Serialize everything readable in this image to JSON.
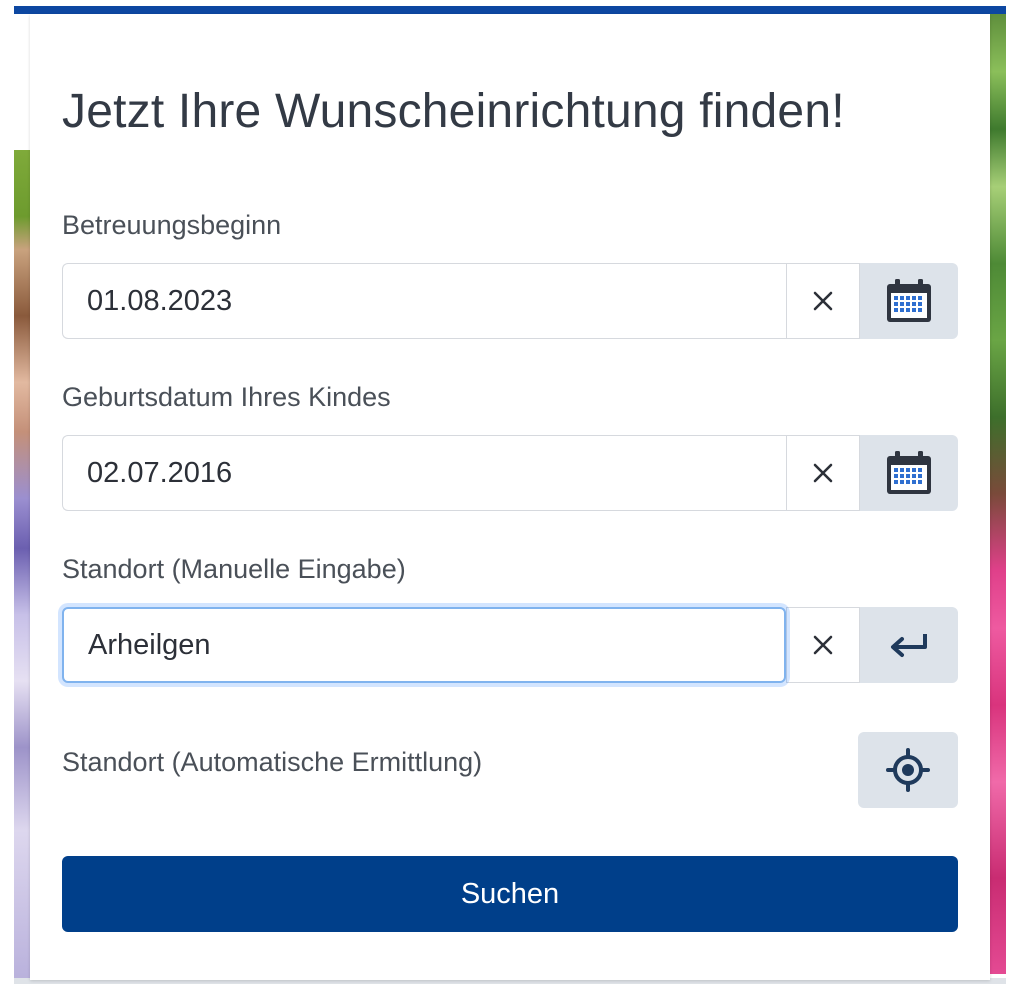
{
  "form": {
    "title": "Jetzt Ihre Wunscheinrichtung finden!",
    "care_start": {
      "label": "Betreuungsbeginn",
      "value": "01.08.2023",
      "clear_icon": "close-icon",
      "action_icon": "calendar-icon"
    },
    "birth_date": {
      "label": "Geburtsdatum Ihres Kindes",
      "value": "02.07.2016",
      "clear_icon": "close-icon",
      "action_icon": "calendar-icon"
    },
    "location_manual": {
      "label": "Standort (Manuelle Eingabe)",
      "value": "Arheilgen",
      "clear_icon": "close-icon",
      "action_icon": "enter-arrow-icon"
    },
    "location_auto": {
      "label": "Standort (Automatische Ermittlung)",
      "action_icon": "crosshair-location-icon"
    },
    "search_label": "Suchen"
  },
  "colors": {
    "primary": "#003f8a",
    "top_bar": "#0d47a1",
    "icon_button_bg": "#dde3ea",
    "focus_border": "#80b3ee"
  }
}
